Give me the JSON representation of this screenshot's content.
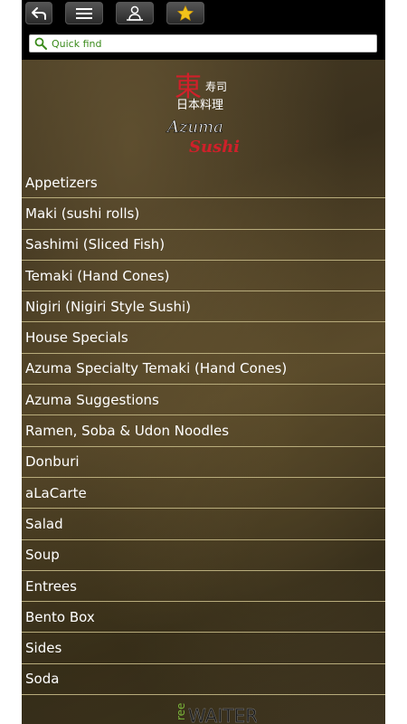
{
  "search": {
    "placeholder": "Quick find"
  },
  "logo": {
    "kanji_main": "東",
    "kanji_small_top": "寿司",
    "kanji_line2": "日本料理",
    "name_line1": "Azuma",
    "name_line2": "Sushi"
  },
  "menu": {
    "items": [
      {
        "label": "Appetizers"
      },
      {
        "label": "Maki (sushi rolls)"
      },
      {
        "label": "Sashimi (Sliced Fish)"
      },
      {
        "label": "Temaki (Hand Cones)"
      },
      {
        "label": "Nigiri (Nigiri Style Sushi)"
      },
      {
        "label": "House Specials"
      },
      {
        "label": "Azuma Specialty Temaki (Hand Cones)"
      },
      {
        "label": "Azuma Suggestions"
      },
      {
        "label": "Ramen, Soba & Udon Noodles"
      },
      {
        "label": "Donburi"
      },
      {
        "label": "aLaCarte"
      },
      {
        "label": "Salad"
      },
      {
        "label": "Soup"
      },
      {
        "label": "Entrees"
      },
      {
        "label": "Bento Box"
      },
      {
        "label": "Sides"
      },
      {
        "label": "Soda"
      }
    ]
  },
  "footer": {
    "brand_side": "ree",
    "brand_main": "WAITER"
  },
  "colors": {
    "accent_green": "#3a8a1a",
    "logo_red": "#d0202a",
    "divider": "#b8ac7c"
  },
  "icons": [
    "back-icon",
    "menu-icon",
    "chef-icon",
    "star-icon",
    "search-icon"
  ]
}
